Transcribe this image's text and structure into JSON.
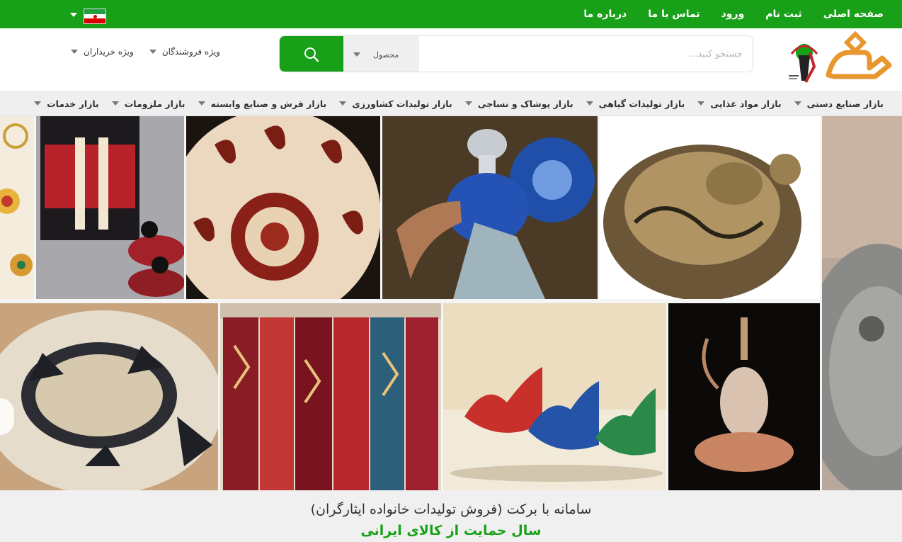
{
  "top_nav": {
    "items": [
      {
        "label": "صفحه اصلی"
      },
      {
        "label": "ثبت نام"
      },
      {
        "label": "ورود"
      },
      {
        "label": "تماس با ما"
      },
      {
        "label": "درباره ما"
      }
    ]
  },
  "header": {
    "search": {
      "placeholder": "جستجو کنید...",
      "category": "محصول",
      "icon": "search-icon"
    },
    "menu": [
      {
        "label": "ویژه فروشندگان"
      },
      {
        "label": "ویژه خریداران"
      }
    ]
  },
  "categories": [
    {
      "label": "بازار صنایع دستی"
    },
    {
      "label": "بازار مواد غذایی"
    },
    {
      "label": "بازار تولیدات گیاهی"
    },
    {
      "label": "بازار پوشاک و نساجی"
    },
    {
      "label": "بازار تولیدات کشاورزی"
    },
    {
      "label": "بازار فرش و صنایع وابسته"
    },
    {
      "label": "بازار ملزومات"
    },
    {
      "label": "بازار خدمات"
    }
  ],
  "hero": {
    "title": "سامانه با برکت (فروش تولیدات خانواده ایثارگران)",
    "subtitle": "سال حمایت از کالای ایرانی"
  },
  "colors": {
    "brand": "#18a019",
    "logo_orange": "#e8962e",
    "logo_red": "#c0272d"
  }
}
